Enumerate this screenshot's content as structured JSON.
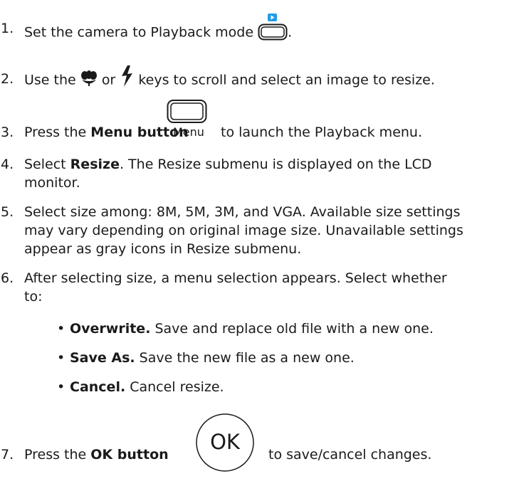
{
  "steps": [
    {
      "number": "1.",
      "text_before": "Set the camera to Playback mode",
      "text_after": "."
    },
    {
      "number": "2.",
      "text_a": "Use the",
      "text_b": "or",
      "text_c": "keys to scroll and select an image to resize."
    },
    {
      "number": "3.",
      "text_a": "Press the",
      "bold": "Menu button",
      "button_label": "Menu",
      "text_c": "to launch the Playback menu."
    },
    {
      "number": "4.",
      "text_a": "Select",
      "bold": "Resize",
      "text_c": ". The Resize submenu is displayed on the LCD",
      "line2": "monitor."
    },
    {
      "number": "5.",
      "line1": "Select size among: 8M, 5M, 3M, and VGA. Available size settings",
      "line2": "may vary depending on original image size. Unavailable settings",
      "line3": "appear as gray icons in Resize submenu."
    },
    {
      "number": "6.",
      "line1": "After selecting size, a menu selection appears. Select whether",
      "line2": "to:"
    },
    {
      "number": "7.",
      "text_a": "Press the",
      "bold": "OK button",
      "button_label": "OK",
      "text_c": "to save/cancel changes."
    }
  ],
  "options": [
    {
      "bold": "Overwrite.",
      "text": "Save and replace old file with a new one."
    },
    {
      "bold": "Save As.",
      "text": "Save the new file as a new one."
    },
    {
      "bold": "Cancel.",
      "text": "Cancel resize."
    }
  ],
  "icons": {
    "playback": "playback-button-icon",
    "macro": "macro-flower-icon",
    "flash": "flash-bolt-icon",
    "menu": "menu-button-icon",
    "ok": "ok-button-icon"
  },
  "colors": {
    "playback_accent": "#1e9be6",
    "text": "#1a1a1a"
  }
}
